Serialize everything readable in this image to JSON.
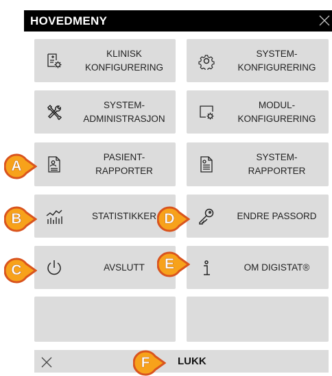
{
  "header": {
    "title": "HOVEDMENY",
    "close_icon": "close-icon"
  },
  "tiles": [
    {
      "label": "KLINISK\nKONFIGURERING",
      "icon": "clinical-config-icon"
    },
    {
      "label": "SYSTEM-\nKONFIGURERING",
      "icon": "gear-icon"
    },
    {
      "label": "SYSTEM-\nADMINISTRASJON",
      "icon": "tools-icon"
    },
    {
      "label": "MODUL-\nKONFIGURERING",
      "icon": "module-config-icon"
    },
    {
      "label": "PASIENT-\nRAPPORTER",
      "icon": "patient-report-icon"
    },
    {
      "label": "SYSTEM-\nRAPPORTER",
      "icon": "system-report-icon"
    },
    {
      "label": "STATISTIKKER",
      "icon": "statistics-icon"
    },
    {
      "label": "ENDRE PASSORD",
      "icon": "key-icon"
    },
    {
      "label": "AVSLUTT",
      "icon": "power-icon"
    },
    {
      "label": "OM DIGISTAT®",
      "icon": "info-icon"
    }
  ],
  "footer": {
    "label": "LUKK",
    "icon": "close-icon"
  },
  "markers": [
    "A",
    "B",
    "C",
    "D",
    "E",
    "F"
  ],
  "colors": {
    "header_bg": "#000000",
    "tile_bg": "#dcdcdc",
    "marker_fill": "#f7a21b",
    "marker_border": "#d9541e"
  }
}
